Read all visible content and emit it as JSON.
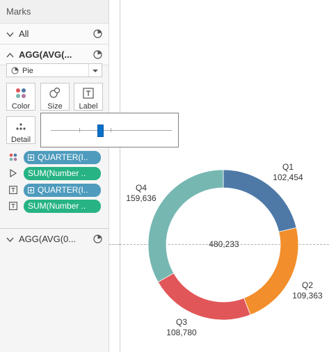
{
  "marks_panel": {
    "title": "Marks",
    "cards": [
      {
        "label": "All"
      },
      {
        "label": "AGG(AVG(..."
      },
      {
        "label": "AGG(AVG(0..."
      }
    ],
    "mark_type": "Pie",
    "buttons": {
      "color": "Color",
      "size": "Size",
      "label": "Label",
      "detail": "Detail"
    },
    "pills": [
      {
        "encoding": "color",
        "text": "QUARTER(I..",
        "color": "#4e9bbd"
      },
      {
        "encoding": "angle",
        "text": "SUM(Number ..",
        "color": "#27b384"
      },
      {
        "encoding": "label",
        "text": "QUARTER(I..",
        "color": "#4e9bbd"
      },
      {
        "encoding": "label",
        "text": "SUM(Number ..",
        "color": "#27b384"
      }
    ]
  },
  "size_popup": {
    "slider_fraction": 0.41
  },
  "chart_data": {
    "type": "pie",
    "donut": true,
    "center_label": "480,233",
    "slices": [
      {
        "category": "Q1",
        "value": 102454,
        "value_label": "102,454",
        "color": "#4e79a7"
      },
      {
        "category": "Q2",
        "value": 109363,
        "value_label": "109,363",
        "color": "#f28e2b"
      },
      {
        "category": "Q3",
        "value": 108780,
        "value_label": "108,780",
        "color": "#e15759"
      },
      {
        "category": "Q4",
        "value": 159636,
        "value_label": "159,636",
        "color": "#76b7b2"
      }
    ]
  }
}
